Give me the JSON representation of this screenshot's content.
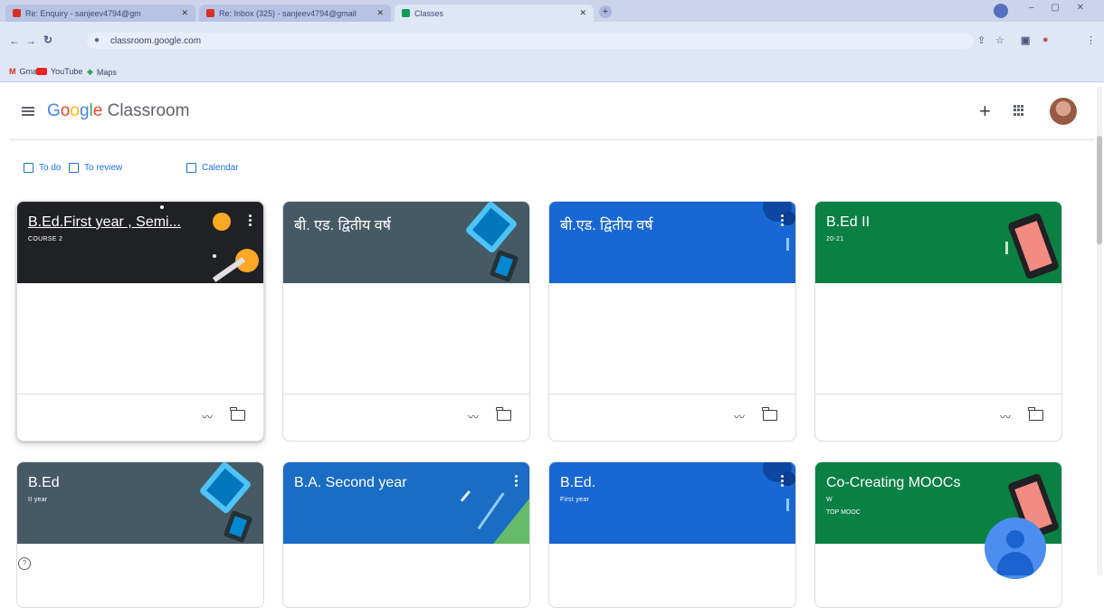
{
  "browser": {
    "tabs": [
      {
        "label": "Re: Enquiry - sanjeev4794@gm",
        "state": "inactive"
      },
      {
        "label": "Re: Inbox (325) - sanjeev4794@gmail",
        "state": "inactive"
      },
      {
        "label": "Classes",
        "state": "active"
      }
    ],
    "new_tab_label": "+",
    "window_controls": "– ▢ ✕",
    "url": "classroom.google.com",
    "bookmarks": [
      "Gmail",
      "YouTube",
      "Maps"
    ]
  },
  "app": {
    "brand_google": [
      "G",
      "o",
      "o",
      "g",
      "l",
      "e"
    ],
    "brand_product": "Classroom",
    "add_label": "+"
  },
  "quick_links": [
    "To do",
    "To review",
    "Calendar"
  ],
  "courses": [
    {
      "title": "B.Ed.First year , Semi...",
      "subtitle": "COURSE 2",
      "section": "",
      "color": "#202124"
    },
    {
      "title": "बी. एड. द्वितीय वर्ष",
      "subtitle": "",
      "section": "",
      "color": "#455a64"
    },
    {
      "title": "बी.एड. द्वितीय वर्ष",
      "subtitle": "",
      "section": "",
      "color": "#1967d2"
    },
    {
      "title": "B.Ed II",
      "subtitle": "20-21",
      "section": "",
      "color": "#0b8043"
    },
    {
      "title": "B.Ed",
      "subtitle": "II year",
      "section": "",
      "color": "#455a64"
    },
    {
      "title": "B.A. Second year",
      "subtitle": "",
      "section": "",
      "color": "#1a6cc4"
    },
    {
      "title": "B.Ed.",
      "subtitle": "First year",
      "section": "",
      "color": "#1967d2"
    },
    {
      "title": "Co-Creating MOOCs",
      "subtitle": "W",
      "section": "TOP MOOC",
      "color": "#0b8043"
    }
  ],
  "help_label": "?"
}
